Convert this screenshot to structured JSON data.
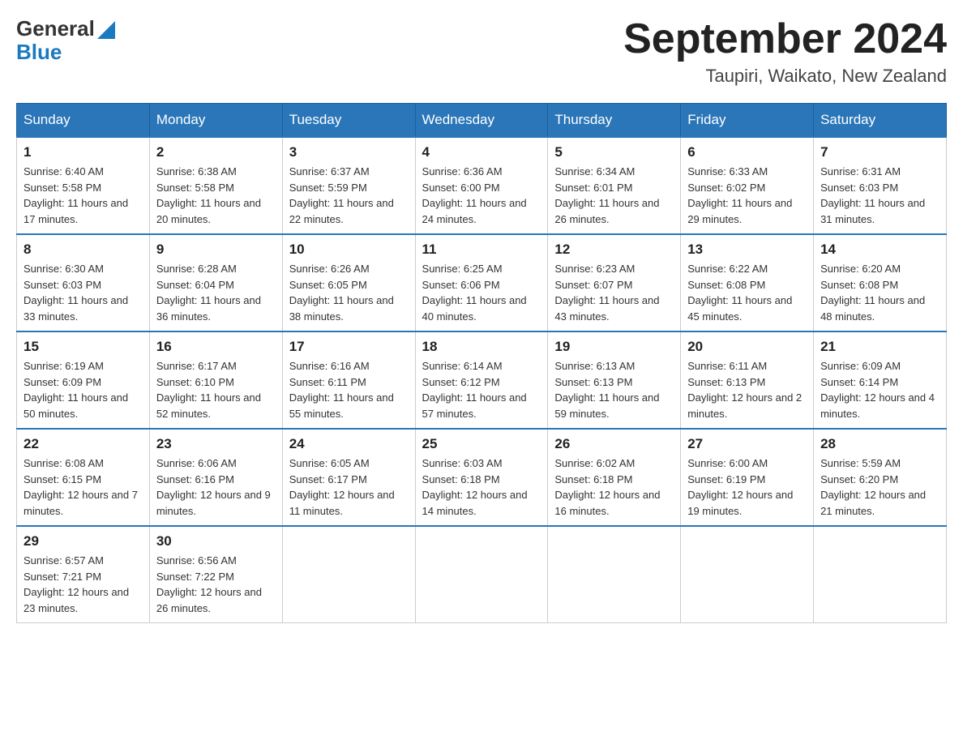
{
  "logo": {
    "general": "General",
    "blue": "Blue"
  },
  "title": "September 2024",
  "subtitle": "Taupiri, Waikato, New Zealand",
  "headers": [
    "Sunday",
    "Monday",
    "Tuesday",
    "Wednesday",
    "Thursday",
    "Friday",
    "Saturday"
  ],
  "weeks": [
    [
      {
        "day": "1",
        "sunrise": "Sunrise: 6:40 AM",
        "sunset": "Sunset: 5:58 PM",
        "daylight": "Daylight: 11 hours and 17 minutes."
      },
      {
        "day": "2",
        "sunrise": "Sunrise: 6:38 AM",
        "sunset": "Sunset: 5:58 PM",
        "daylight": "Daylight: 11 hours and 20 minutes."
      },
      {
        "day": "3",
        "sunrise": "Sunrise: 6:37 AM",
        "sunset": "Sunset: 5:59 PM",
        "daylight": "Daylight: 11 hours and 22 minutes."
      },
      {
        "day": "4",
        "sunrise": "Sunrise: 6:36 AM",
        "sunset": "Sunset: 6:00 PM",
        "daylight": "Daylight: 11 hours and 24 minutes."
      },
      {
        "day": "5",
        "sunrise": "Sunrise: 6:34 AM",
        "sunset": "Sunset: 6:01 PM",
        "daylight": "Daylight: 11 hours and 26 minutes."
      },
      {
        "day": "6",
        "sunrise": "Sunrise: 6:33 AM",
        "sunset": "Sunset: 6:02 PM",
        "daylight": "Daylight: 11 hours and 29 minutes."
      },
      {
        "day": "7",
        "sunrise": "Sunrise: 6:31 AM",
        "sunset": "Sunset: 6:03 PM",
        "daylight": "Daylight: 11 hours and 31 minutes."
      }
    ],
    [
      {
        "day": "8",
        "sunrise": "Sunrise: 6:30 AM",
        "sunset": "Sunset: 6:03 PM",
        "daylight": "Daylight: 11 hours and 33 minutes."
      },
      {
        "day": "9",
        "sunrise": "Sunrise: 6:28 AM",
        "sunset": "Sunset: 6:04 PM",
        "daylight": "Daylight: 11 hours and 36 minutes."
      },
      {
        "day": "10",
        "sunrise": "Sunrise: 6:26 AM",
        "sunset": "Sunset: 6:05 PM",
        "daylight": "Daylight: 11 hours and 38 minutes."
      },
      {
        "day": "11",
        "sunrise": "Sunrise: 6:25 AM",
        "sunset": "Sunset: 6:06 PM",
        "daylight": "Daylight: 11 hours and 40 minutes."
      },
      {
        "day": "12",
        "sunrise": "Sunrise: 6:23 AM",
        "sunset": "Sunset: 6:07 PM",
        "daylight": "Daylight: 11 hours and 43 minutes."
      },
      {
        "day": "13",
        "sunrise": "Sunrise: 6:22 AM",
        "sunset": "Sunset: 6:08 PM",
        "daylight": "Daylight: 11 hours and 45 minutes."
      },
      {
        "day": "14",
        "sunrise": "Sunrise: 6:20 AM",
        "sunset": "Sunset: 6:08 PM",
        "daylight": "Daylight: 11 hours and 48 minutes."
      }
    ],
    [
      {
        "day": "15",
        "sunrise": "Sunrise: 6:19 AM",
        "sunset": "Sunset: 6:09 PM",
        "daylight": "Daylight: 11 hours and 50 minutes."
      },
      {
        "day": "16",
        "sunrise": "Sunrise: 6:17 AM",
        "sunset": "Sunset: 6:10 PM",
        "daylight": "Daylight: 11 hours and 52 minutes."
      },
      {
        "day": "17",
        "sunrise": "Sunrise: 6:16 AM",
        "sunset": "Sunset: 6:11 PM",
        "daylight": "Daylight: 11 hours and 55 minutes."
      },
      {
        "day": "18",
        "sunrise": "Sunrise: 6:14 AM",
        "sunset": "Sunset: 6:12 PM",
        "daylight": "Daylight: 11 hours and 57 minutes."
      },
      {
        "day": "19",
        "sunrise": "Sunrise: 6:13 AM",
        "sunset": "Sunset: 6:13 PM",
        "daylight": "Daylight: 11 hours and 59 minutes."
      },
      {
        "day": "20",
        "sunrise": "Sunrise: 6:11 AM",
        "sunset": "Sunset: 6:13 PM",
        "daylight": "Daylight: 12 hours and 2 minutes."
      },
      {
        "day": "21",
        "sunrise": "Sunrise: 6:09 AM",
        "sunset": "Sunset: 6:14 PM",
        "daylight": "Daylight: 12 hours and 4 minutes."
      }
    ],
    [
      {
        "day": "22",
        "sunrise": "Sunrise: 6:08 AM",
        "sunset": "Sunset: 6:15 PM",
        "daylight": "Daylight: 12 hours and 7 minutes."
      },
      {
        "day": "23",
        "sunrise": "Sunrise: 6:06 AM",
        "sunset": "Sunset: 6:16 PM",
        "daylight": "Daylight: 12 hours and 9 minutes."
      },
      {
        "day": "24",
        "sunrise": "Sunrise: 6:05 AM",
        "sunset": "Sunset: 6:17 PM",
        "daylight": "Daylight: 12 hours and 11 minutes."
      },
      {
        "day": "25",
        "sunrise": "Sunrise: 6:03 AM",
        "sunset": "Sunset: 6:18 PM",
        "daylight": "Daylight: 12 hours and 14 minutes."
      },
      {
        "day": "26",
        "sunrise": "Sunrise: 6:02 AM",
        "sunset": "Sunset: 6:18 PM",
        "daylight": "Daylight: 12 hours and 16 minutes."
      },
      {
        "day": "27",
        "sunrise": "Sunrise: 6:00 AM",
        "sunset": "Sunset: 6:19 PM",
        "daylight": "Daylight: 12 hours and 19 minutes."
      },
      {
        "day": "28",
        "sunrise": "Sunrise: 5:59 AM",
        "sunset": "Sunset: 6:20 PM",
        "daylight": "Daylight: 12 hours and 21 minutes."
      }
    ],
    [
      {
        "day": "29",
        "sunrise": "Sunrise: 6:57 AM",
        "sunset": "Sunset: 7:21 PM",
        "daylight": "Daylight: 12 hours and 23 minutes."
      },
      {
        "day": "30",
        "sunrise": "Sunrise: 6:56 AM",
        "sunset": "Sunset: 7:22 PM",
        "daylight": "Daylight: 12 hours and 26 minutes."
      },
      null,
      null,
      null,
      null,
      null
    ]
  ]
}
